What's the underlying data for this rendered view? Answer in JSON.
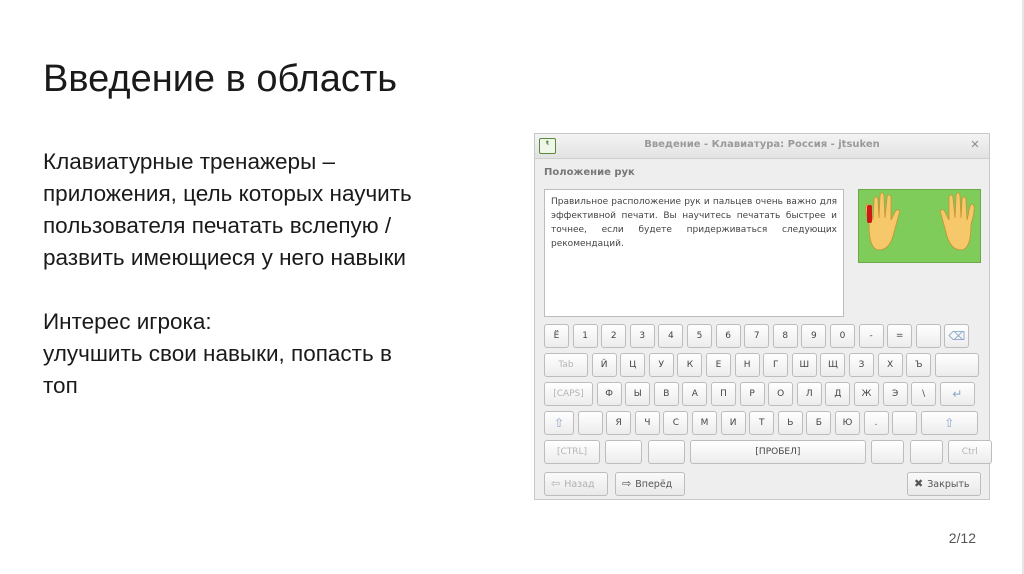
{
  "slide": {
    "title": "Введение в область",
    "paragraph1": [
      "Клавиатурные тренажеры –",
      "приложения, цель которых научить",
      "пользователя печатать вслепую /",
      "развить имеющиеся у него навыки"
    ],
    "paragraph2": [
      "Интерес игрока:",
      "улучшить свои навыки, попасть в",
      "топ"
    ],
    "page_number": "2/12"
  },
  "app": {
    "window_title": "Введение - Клавиатура: Россия - jtsuken",
    "section_title": "Положение рук",
    "description": "Правильное расположение рук и пальцев очень важно для эффективной печати. Вы научитесь печатать быстрее и точнее, если будете придерживаться следующих рекомендаций.",
    "keyboard": {
      "row1": [
        "Ё",
        "1",
        "2",
        "3",
        "4",
        "5",
        "6",
        "7",
        "8",
        "9",
        "0",
        "-",
        "=",
        "",
        ""
      ],
      "row2": [
        "Tab",
        "Й",
        "Ц",
        "У",
        "К",
        "Е",
        "Н",
        "Г",
        "Ш",
        "Щ",
        "З",
        "Х",
        "Ъ",
        ""
      ],
      "row3": [
        "[CAPS]",
        "Ф",
        "Ы",
        "В",
        "А",
        "П",
        "Р",
        "О",
        "Л",
        "Д",
        "Ж",
        "Э",
        "\\",
        ""
      ],
      "row4": [
        "",
        "",
        "Я",
        "Ч",
        "С",
        "М",
        "И",
        "Т",
        "Ь",
        "Б",
        "Ю",
        ".",
        "",
        ""
      ],
      "row5": [
        "[CTRL]",
        "",
        "",
        "[ПРОБЕЛ]",
        "",
        "",
        "Ctrl"
      ]
    },
    "buttons": {
      "back": "Назад",
      "forward": "Вперёд",
      "close": "Закрыть"
    },
    "colors": {
      "hands_bg": "#7fcc5a",
      "finger_highlight": "#d01818"
    }
  }
}
